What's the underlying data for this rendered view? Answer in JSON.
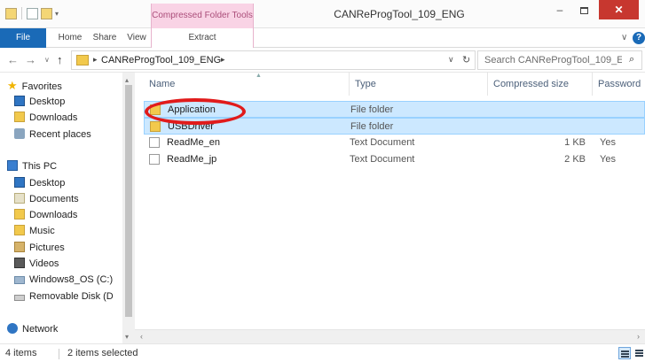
{
  "window": {
    "title": "CANReProgTool_109_ENG",
    "context_tab_group": "Compressed Folder Tools",
    "minimize": "–",
    "maximize": "",
    "close": "✕"
  },
  "ribbon": {
    "tabs": [
      "File",
      "Home",
      "Share",
      "View",
      "Extract"
    ],
    "expand": "∨",
    "help": "?"
  },
  "nav": {
    "back": "←",
    "forward": "→",
    "recent": "∨",
    "up": "↑"
  },
  "address": {
    "separator": "▸",
    "crumb": "CANReProgTool_109_ENG",
    "dropdown": "∨",
    "refresh": "↻"
  },
  "search": {
    "placeholder": "Search CANReProgTool_109_E...",
    "icon": "⌕"
  },
  "navpane": {
    "items": [
      {
        "label": "Favorites",
        "icon": "star-icon"
      },
      {
        "label": "Desktop",
        "icon": "desktop-icon"
      },
      {
        "label": "Downloads",
        "icon": "downloads-icon"
      },
      {
        "label": "Recent places",
        "icon": "recent-places-icon"
      },
      {
        "label": "This PC",
        "icon": "computer-icon"
      },
      {
        "label": "Desktop",
        "icon": "desktop-icon"
      },
      {
        "label": "Documents",
        "icon": "documents-icon"
      },
      {
        "label": "Downloads",
        "icon": "downloads-icon"
      },
      {
        "label": "Music",
        "icon": "music-icon"
      },
      {
        "label": "Pictures",
        "icon": "pictures-icon"
      },
      {
        "label": "Videos",
        "icon": "videos-icon"
      },
      {
        "label": "Windows8_OS (C:)",
        "icon": "drive-icon"
      },
      {
        "label": "Removable Disk (D",
        "icon": "removable-disk-icon"
      },
      {
        "label": "Network",
        "icon": "network-icon"
      }
    ],
    "scroll_up": "▴",
    "scroll_down": "▾"
  },
  "filelist": {
    "columns": [
      "Name",
      "Type",
      "Compressed size",
      "Password p"
    ],
    "sort_indicator": "▲",
    "rows": [
      {
        "name": "Application",
        "type": "File folder",
        "size": "",
        "password": "",
        "selected": true,
        "icon": "folder-icon"
      },
      {
        "name": "USBDriver",
        "type": "File folder",
        "size": "",
        "password": "",
        "selected": true,
        "icon": "folder-icon"
      },
      {
        "name": "ReadMe_en",
        "type": "Text Document",
        "size": "1 KB",
        "password": "Yes",
        "selected": false,
        "icon": "text-document-icon"
      },
      {
        "name": "ReadMe_jp",
        "type": "Text Document",
        "size": "2 KB",
        "password": "Yes",
        "selected": false,
        "icon": "text-document-icon"
      }
    ],
    "hscroll_left": "‹",
    "hscroll_right": "›"
  },
  "annotation": {
    "color": "#e11b1b",
    "target": "Application"
  },
  "status": {
    "count": "4 items",
    "selected": "2 items selected"
  },
  "colors": {
    "file_tab": "#1a6ab7",
    "context_tab": "#f9d3e5",
    "selection": "#cce8ff",
    "close_button": "#c7372f"
  }
}
